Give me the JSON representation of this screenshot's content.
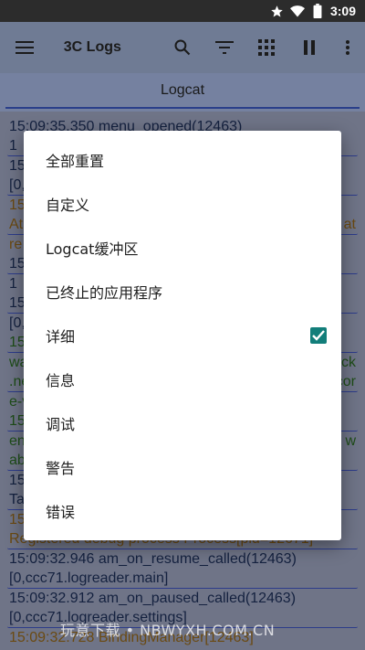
{
  "status_bar": {
    "time": "3:09"
  },
  "toolbar": {
    "title": "3C Logs"
  },
  "tab": {
    "label": "Logcat"
  },
  "log_entries": [
    {
      "text": "15:09:35.350 menu_opened(12463)",
      "color": "blue"
    },
    {
      "text": "1",
      "color": "blue"
    },
    {
      "text": "15",
      "color": "blue"
    },
    {
      "text": "[0,",
      "color": "blue"
    },
    {
      "text": "15",
      "color": "orange"
    },
    {
      "text": "At",
      "color": "orange",
      "tail": "at"
    },
    {
      "text": "re",
      "color": "orange"
    },
    {
      "text": "15",
      "color": "blue"
    },
    {
      "text": "1",
      "color": "blue"
    },
    {
      "text": "15",
      "color": "blue"
    },
    {
      "text": "[0,",
      "color": "blue"
    },
    {
      "text": "15",
      "color": "green"
    },
    {
      "text": "wa",
      "color": "green",
      "tail": "ck"
    },
    {
      "text": ".ne",
      "color": "green",
      "tail": "cor"
    },
    {
      "text": "e-v",
      "color": "green"
    },
    {
      "text": "15",
      "color": "green"
    },
    {
      "text": "en",
      "color": "green",
      "tail": "w"
    },
    {
      "text": "ab",
      "color": "green"
    },
    {
      "text": "15",
      "color": "blue"
    },
    {
      "text": "Ta",
      "color": "blue"
    },
    {
      "text": "15",
      "color": "orange"
    },
    {
      "text": "Registered debug process Process[pid=12671]",
      "color": "orange"
    },
    {
      "text": "15:09:32.946 am_on_resume_called(12463)",
      "color": "blue"
    },
    {
      "text": "[0,ccc71.logreader.main]",
      "color": "blue"
    },
    {
      "text": "15:09:32.912 am_on_paused_called(12463)",
      "color": "blue"
    },
    {
      "text": "[0,ccc71.logreader.settings]",
      "color": "blue"
    },
    {
      "text": "15:09:32.728 BindingManager[12463]",
      "color": "orange"
    }
  ],
  "dialog": {
    "items": [
      {
        "label": "全部重置",
        "checked": false
      },
      {
        "label": "自定义",
        "checked": false
      },
      {
        "label": "Logcat缓冲区",
        "checked": false
      },
      {
        "label": "已终止的应用程序",
        "checked": false
      },
      {
        "label": "详细",
        "checked": true
      },
      {
        "label": "信息",
        "checked": false
      },
      {
        "label": "调试",
        "checked": false
      },
      {
        "label": "警告",
        "checked": false
      },
      {
        "label": "错误",
        "checked": false
      }
    ]
  },
  "watermark": "玩意下载 • NBWYXH.COM.CN",
  "colors": {
    "accent": "#127e7a",
    "toolbar": "#6f7b94",
    "border": "#2d3c8a"
  }
}
